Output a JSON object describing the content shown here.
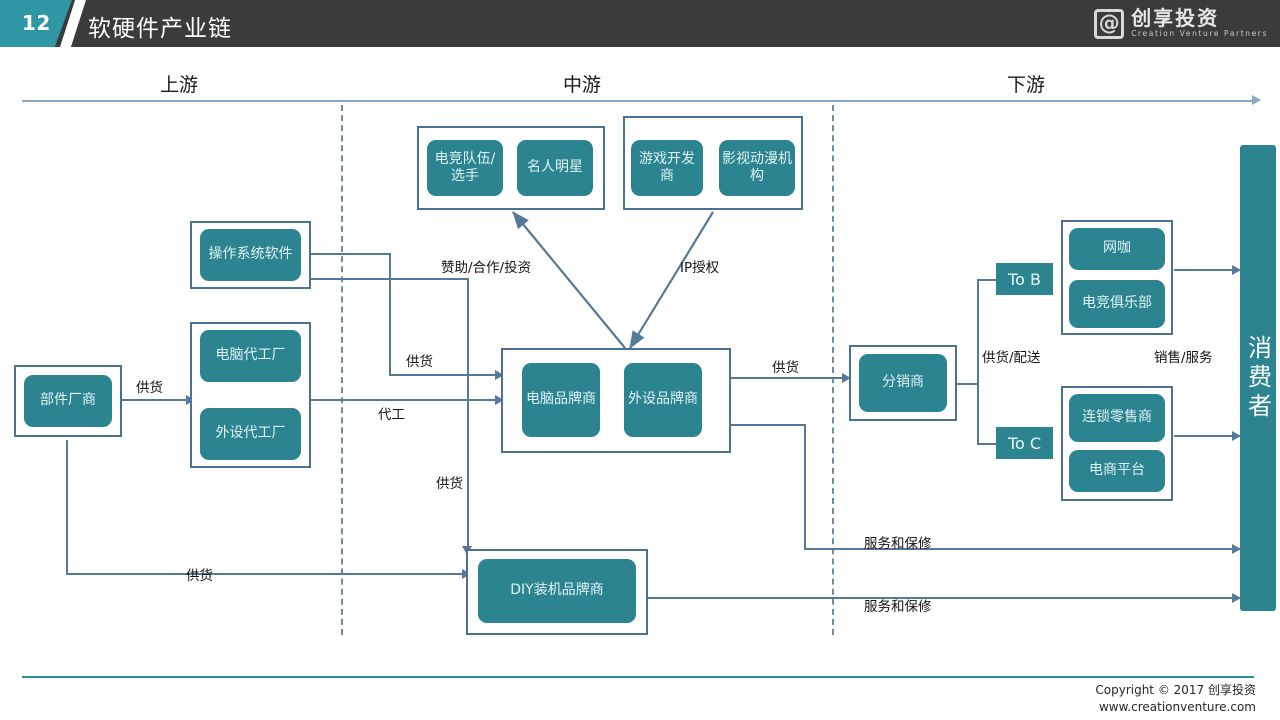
{
  "header": {
    "slide_number": "12",
    "title": "软硬件产业链",
    "logo_cn": "创享投资",
    "logo_en": "Creation Venture Partners",
    "logo_icon": "at-mark-logo-icon"
  },
  "stages": [
    {
      "label": "上游"
    },
    {
      "label": "中游"
    },
    {
      "label": "下游"
    }
  ],
  "nodes": {
    "component_maker": "部件厂商",
    "os_software": "操作系统软件",
    "pc_oem": "电脑代工厂",
    "peripheral_oem": "外设代工厂",
    "esports_team": "电竞队伍/选手",
    "celebrity": "名人明星",
    "game_dev": "游戏开发商",
    "film_anime": "影视动漫机构",
    "pc_brand": "电脑品牌商",
    "peripheral_brand": "外设品牌商",
    "diy_brand": "DIY装机品牌商",
    "distributor": "分销商",
    "to_b": "To B",
    "to_c": "To C",
    "internet_cafe": "网咖",
    "esports_club": "电竞俱乐部",
    "chain_retail": "连锁零售商",
    "ecommerce": "电商平台",
    "consumer": "消费者"
  },
  "edge_labels": {
    "supply_1": "供货",
    "supply_2": "供货",
    "supply_3": "供货",
    "supply_4": "供货",
    "supply_5": "供货",
    "oem": "代工",
    "sponsor": "赞助/合作/投资",
    "ip_license": "IP授权",
    "supply_delivery": "供货/配送",
    "sales_service": "销售/服务",
    "service_warranty_1": "服务和保修",
    "service_warranty_2": "服务和保修"
  },
  "footer": {
    "copyright": "Copyright © 2017 创享投资",
    "website": "www.creationventure.com"
  },
  "colors": {
    "header_bar": "#3b3b3d",
    "accent_teal": "#2b8490",
    "node_border": "#4a7294",
    "connector": "#56799a",
    "axis": "#8aa9c4"
  }
}
